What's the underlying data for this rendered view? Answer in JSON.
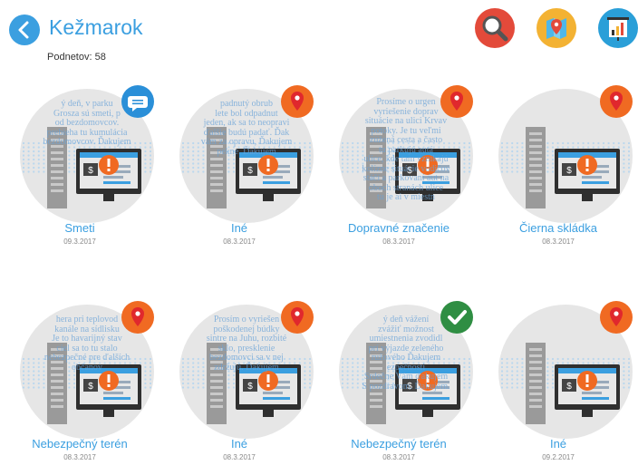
{
  "header": {
    "title": "Kežmarok",
    "count_label": "Podnetov: 58"
  },
  "colors": {
    "accent": "#3b9fe0",
    "search_bg": "#e34a3a",
    "map_bg": "#f3b233",
    "stats_bg": "#2a9fd8",
    "pin_bg": "#f06a22",
    "chat_bg": "#2a8fd8",
    "check_bg": "#2f8e43"
  },
  "toolbar": {
    "search_icon": "search-icon",
    "map_icon": "map-icon",
    "stats_icon": "bar-chart-icon"
  },
  "reports": [
    {
      "title": "Smeti",
      "date": "09.3.2017",
      "status_icon": "chat-bubble-icon",
      "bg_text": [
        "ý deň, v parku",
        "Grosza sú smeti, p",
        "od bezdomovcov.",
        "prebieha tu kumulácia",
        "bezdomovcov. Ďakujem"
      ]
    },
    {
      "title": "Iné",
      "date": "08.3.2017",
      "status_icon": "location-pin-icon",
      "bg_text": [
        "padnutý obrub",
        "lete bol odpadnut",
        "jeden, ak sa to neopravi",
        "ďalšie budú padať. Ďak",
        "vám za opravu, Ďakujem",
        "pekne. Ďakujem"
      ]
    },
    {
      "title": "Dopravné značenie",
      "date": "08.3.2017",
      "status_icon": "location-pin-icon",
      "bg_text": [
        "Prosíme o urgen",
        "vyriešenie doprav",
        "situácie na ulici Krvav",
        "potoky. Je tu veľmi",
        "zúžená cesta a často",
        "tu parkujú autá",
        "ulice, kde tam vznikajú",
        "kolízne situácie vodičov",
        "stáčí a parkovaní áut na",
        "oboch stranách ulice",
        "tu je ai v miestn"
      ]
    },
    {
      "title": "Čierna skládka",
      "date": "08.3.2017",
      "status_icon": "location-pin-icon",
      "bg_text": []
    },
    {
      "title": "Nebezpečný terén",
      "date": "08.3.2017",
      "status_icon": "location-pin-icon",
      "bg_text": [
        "hera pri teplovod",
        "kanále na sídlisku",
        "Je to havarijný stav",
        "ciel sa to tu stalo",
        "nebezpečné pre ďalších",
        "občanov"
      ]
    },
    {
      "title": "Iné",
      "date": "08.3.2017",
      "status_icon": "location-pin-icon",
      "bg_text": [
        "Prosím o vyriešen",
        "poškodenej búdky",
        "sintre na Juhu, rozbité",
        "sklo, presklenie",
        "bezdomovci sa v nej",
        "zdržujú. Ďakujem"
      ]
    },
    {
      "title": "Nebezpečný terén",
      "date": "08.3.2017",
      "status_icon": "check-icon",
      "bg_text": [
        "ý deň vážení",
        "zvážiť možnost",
        "umiestnenia zvodidl",
        "pri výjazde zeleného",
        "ružového Ďakujem",
        "ezpečnosti",
        "Srdečne Vám ďakujem",
        "S pozdravom. Ďakujem."
      ]
    },
    {
      "title": "Iné",
      "date": "09.2.2017",
      "status_icon": "location-pin-icon",
      "bg_text": []
    }
  ]
}
